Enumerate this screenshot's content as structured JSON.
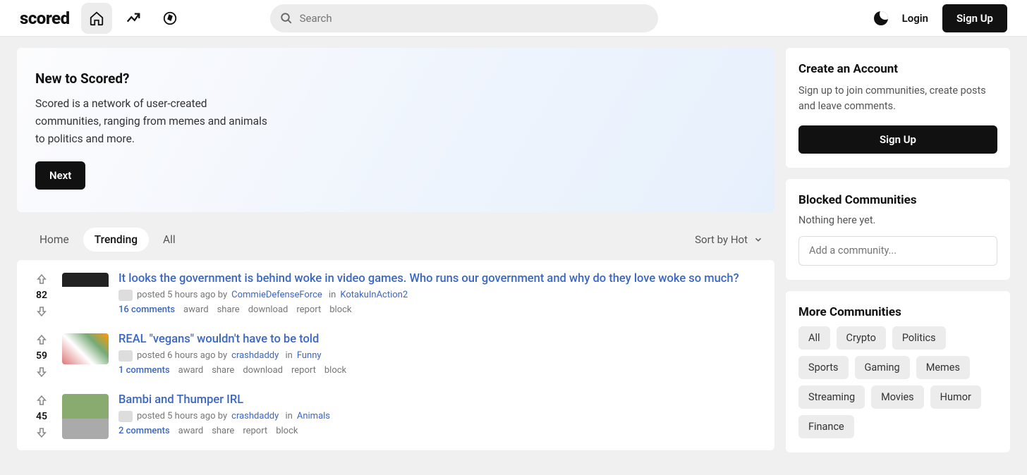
{
  "brand": "scored",
  "search": {
    "placeholder": "Search"
  },
  "auth": {
    "login": "Login",
    "signup": "Sign Up"
  },
  "hero": {
    "title": "New to Scored?",
    "body": "Scored is a network of user-created communities, ranging from memes and animals to politics and more.",
    "cta": "Next"
  },
  "tabs": [
    "Home",
    "Trending",
    "All"
  ],
  "active_tab": "Trending",
  "sort": {
    "label": "Sort by Hot"
  },
  "posts": [
    {
      "score": "82",
      "title": "It looks the government is behind woke in video games. Who runs our government and why do they love woke so much?",
      "time": "posted 5 hours ago by",
      "author": "CommieDefenseForce",
      "in": "in",
      "community": "KotakuInAction2",
      "comments": "16 comments",
      "actions": [
        "award",
        "share",
        "download",
        "report",
        "block"
      ],
      "thumbClass": "t1"
    },
    {
      "score": "59",
      "title": "REAL \"vegans\" wouldn't have to be told",
      "time": "posted 6 hours ago by",
      "author": "crashdaddy",
      "in": "in",
      "community": "Funny",
      "comments": "1 comments",
      "actions": [
        "award",
        "share",
        "download",
        "report",
        "block"
      ],
      "thumbClass": "t2"
    },
    {
      "score": "45",
      "title": "Bambi and Thumper IRL",
      "time": "posted 5 hours ago by",
      "author": "crashdaddy",
      "in": "in",
      "community": "Animals",
      "comments": "2 comments",
      "actions": [
        "award",
        "share",
        "report",
        "block"
      ],
      "thumbClass": "t3"
    }
  ],
  "sidebar": {
    "account": {
      "title": "Create an Account",
      "body": "Sign up to join communities, create posts and leave comments.",
      "cta": "Sign Up"
    },
    "blocked": {
      "title": "Blocked Communities",
      "empty": "Nothing here yet.",
      "placeholder": "Add a community..."
    },
    "more": {
      "title": "More Communities",
      "chips": [
        "All",
        "Crypto",
        "Politics",
        "Sports",
        "Gaming",
        "Memes",
        "Streaming",
        "Movies",
        "Humor",
        "Finance"
      ]
    }
  }
}
